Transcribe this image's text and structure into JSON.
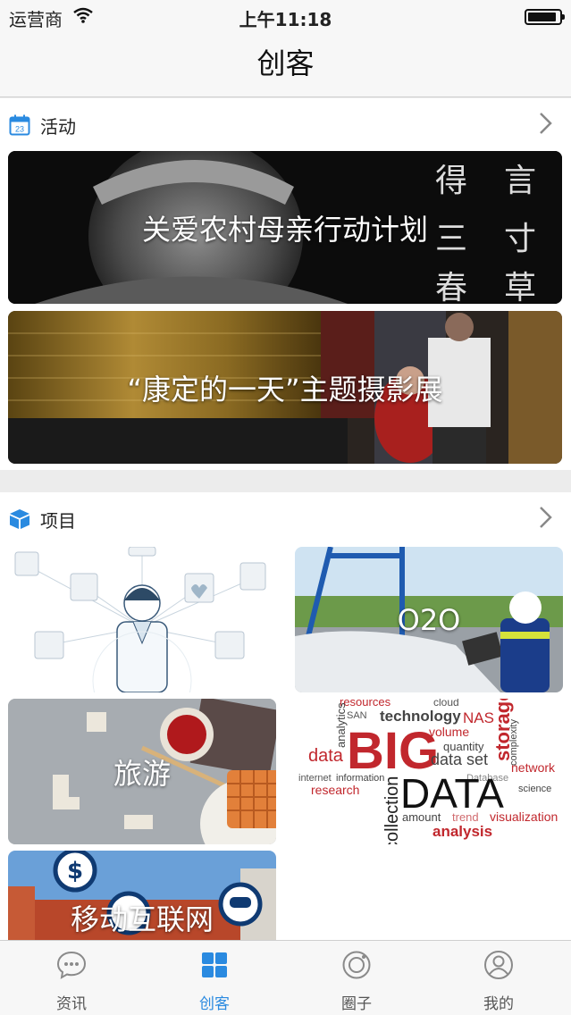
{
  "status_bar": {
    "carrier": "运营商",
    "time": "上午11:18",
    "battery_level": 0.9
  },
  "nav": {
    "title": "创客"
  },
  "activities": {
    "label": "活动",
    "calendar_day": "23",
    "items": [
      {
        "title": "关爱农村母亲行动计划"
      },
      {
        "title": "“康定的一天”主题摄影展"
      }
    ]
  },
  "projects": {
    "label": "项目",
    "items": [
      {
        "title": ""
      },
      {
        "title": "O2O"
      },
      {
        "title": "旅游"
      },
      {
        "title": ""
      },
      {
        "title": "移动互联网"
      }
    ]
  },
  "bigdata_words": {
    "big": "BIG",
    "data": "DATA",
    "technology": "technology",
    "resources": "resources",
    "cloud": "cloud",
    "nas": "NAS",
    "volume": "volume",
    "quantity": "quantity",
    "data_small": "data",
    "data_set": "data set",
    "network": "network",
    "storage": "storage",
    "research": "research",
    "analysis": "analysis",
    "visualization": "visualization",
    "amount": "amount",
    "trend": "trend",
    "science": "science",
    "analytics": "analytics",
    "san": "SAN",
    "information": "information",
    "internet": "internet",
    "database": "Database",
    "complexity": "complexity",
    "collection": "collection"
  },
  "tabbar": {
    "items": [
      {
        "label": "资讯",
        "icon": "chat-bubble-icon"
      },
      {
        "label": "创客",
        "icon": "grid-icon"
      },
      {
        "label": "圈子",
        "icon": "circle-icon"
      },
      {
        "label": "我的",
        "icon": "user-icon"
      }
    ]
  },
  "colors": {
    "accent": "#2a8ae0",
    "inactive": "#8a8a8a"
  }
}
